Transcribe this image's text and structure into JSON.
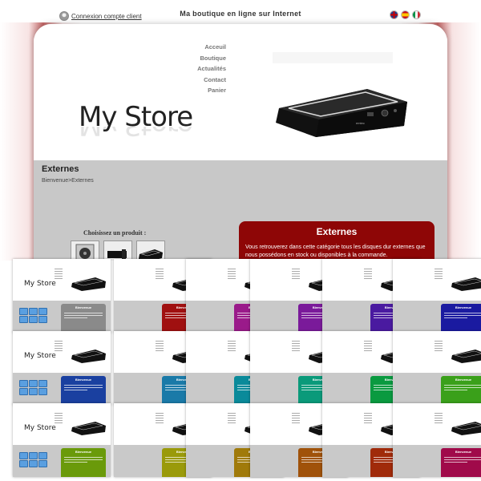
{
  "topbar": {
    "login_label": "Connexion compte client",
    "site_title": "Ma boutique en ligne sur Internet",
    "languages": [
      "en-flag",
      "es-flag",
      "it-flag"
    ]
  },
  "nav": {
    "items": [
      "Acceuil",
      "Boutique",
      "Actualités",
      "Contact",
      "Panier"
    ]
  },
  "logo": {
    "text": "My Store"
  },
  "page": {
    "title": "Externes",
    "breadcrumb": "Bienvenue>Externes",
    "choose_label": "Choisissez un produit :"
  },
  "category_box": {
    "title": "Externes",
    "text": "Vous retrouverez dans cette catégorie tous les disques dur externes que nous possédons en stock ou disponibles à la commande.",
    "color": "#8e0606"
  },
  "themes": {
    "panel_title": "Bienvenue",
    "colors": [
      "#8a8a8a",
      "#a01010",
      "#9a1a8a",
      "#7a1a9a",
      "#4a1aa0",
      "#1a1aa0",
      "#1a40a0",
      "#1a7aa8",
      "#0a8a9a",
      "#0a9a7a",
      "#0a9a40",
      "#3aa01a",
      "#6a9a0a",
      "#9a9a0a",
      "#a07a0a",
      "#a0520a",
      "#a02a0a",
      "#a00a4a"
    ]
  }
}
